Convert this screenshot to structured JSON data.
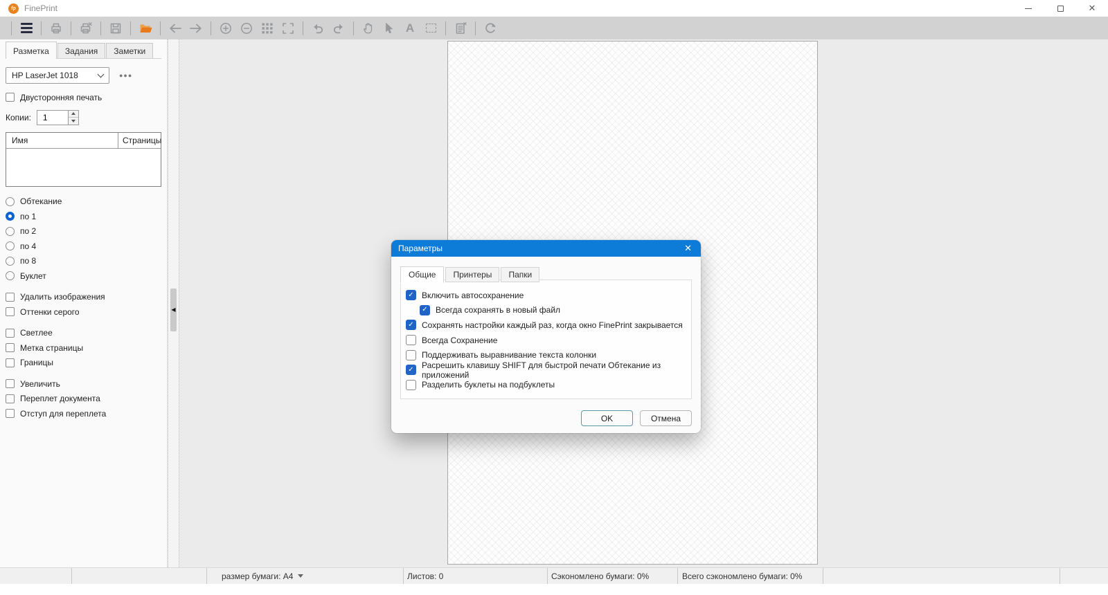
{
  "window": {
    "title": "FinePrint",
    "controls": [
      "minimize-icon",
      "restore-icon",
      "close-icon"
    ]
  },
  "toolbar": {
    "icons": [
      "menu",
      "print",
      "print-delete",
      "save",
      "open",
      "back",
      "forward",
      "zoom-in",
      "zoom-out",
      "grid",
      "fit-page",
      "undo",
      "redo",
      "hand",
      "pointer",
      "text",
      "select",
      "notes",
      "refresh"
    ]
  },
  "sidebar": {
    "tabs": [
      {
        "label": "Разметка",
        "active": true
      },
      {
        "label": "Задания",
        "active": false
      },
      {
        "label": "Заметки",
        "active": false
      }
    ],
    "printer_select": {
      "value": "HP LaserJet 1018"
    },
    "more_label": "●●●",
    "duplex": {
      "label": "Двусторонняя печать",
      "checked": false
    },
    "copies": {
      "label": "Копии:",
      "value": "1"
    },
    "job_table": {
      "columns": [
        "Имя",
        "Страницы"
      ],
      "rows": []
    },
    "layout_radios": [
      {
        "label": "Обтекание",
        "selected": false
      },
      {
        "label": "по 1",
        "selected": true
      },
      {
        "label": "по 2",
        "selected": false
      },
      {
        "label": "по 4",
        "selected": false
      },
      {
        "label": "по 8",
        "selected": false
      },
      {
        "label": "Буклет",
        "selected": false
      }
    ],
    "option_groups": [
      [
        {
          "label": "Удалить изображения",
          "checked": false
        },
        {
          "label": "Оттенки серого",
          "checked": false
        }
      ],
      [
        {
          "label": "Светлее",
          "checked": false
        },
        {
          "label": "Метка страницы",
          "checked": false
        },
        {
          "label": "Границы",
          "checked": false
        }
      ],
      [
        {
          "label": "Увеличить",
          "checked": false
        },
        {
          "label": "Переплет документа",
          "checked": false
        },
        {
          "label": "Отступ для переплета",
          "checked": false
        }
      ]
    ]
  },
  "statusbar": {
    "paper_size": "размер бумаги: A4",
    "sheets": "Листов: 0",
    "saved": "Сэкономлено бумаги: 0%",
    "total_saved": "Всего сэкономлено бумаги: 0%"
  },
  "dialog": {
    "title": "Параметры",
    "tabs": [
      {
        "label": "Общие",
        "active": true
      },
      {
        "label": "Принтеры",
        "active": false
      },
      {
        "label": "Папки",
        "active": false
      }
    ],
    "checkboxes": [
      {
        "label": "Включить автосохранение",
        "checked": true,
        "indent": 0
      },
      {
        "label": "Всегда сохранять в новый файл",
        "checked": true,
        "indent": 1
      },
      {
        "label": "Сохранять настройки каждый раз, когда окно FinePrint закрывается",
        "checked": true,
        "indent": 0
      },
      {
        "label": "Всегда Сохранение",
        "checked": false,
        "indent": 0
      },
      {
        "label": "Поддерживать выравнивание текста колонки",
        "checked": false,
        "indent": 0
      },
      {
        "label": "Расрешить клавишу SHIFT для быстрой печати Обтекание из приложений",
        "checked": true,
        "indent": 0
      },
      {
        "label": "Разделить буклеты на подбуклеты",
        "checked": false,
        "indent": 0
      }
    ],
    "ok_label": "OK",
    "cancel_label": "Отмена"
  },
  "colors": {
    "accent_blue": "#0d7cd8",
    "check_blue": "#2064c6",
    "folder_orange": "#e8821e"
  }
}
